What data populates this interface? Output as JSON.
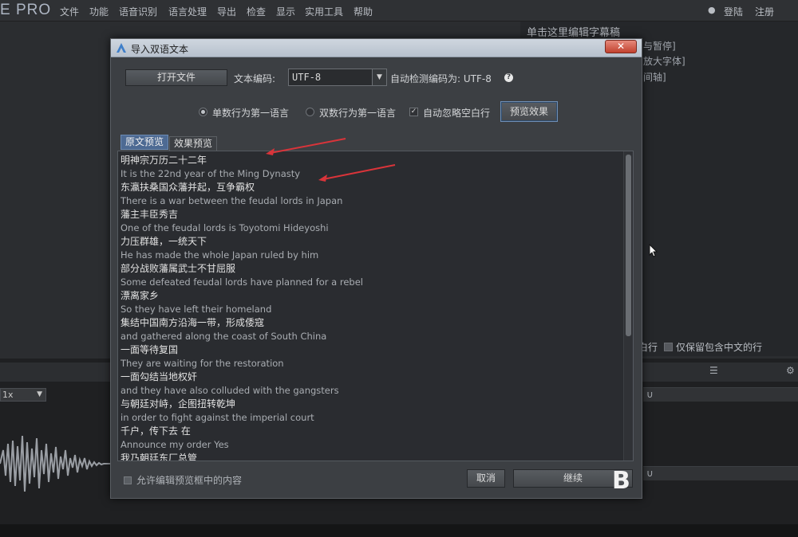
{
  "app": {
    "logo": "E PRO",
    "menu": [
      "文件",
      "功能",
      "语音识别",
      "语言处理",
      "导出",
      "检查",
      "显示",
      "实用工具",
      "帮助"
    ],
    "user": [
      "登陆",
      "注册"
    ]
  },
  "background": {
    "edit_hint": "单击这里编辑字幕稿",
    "side_lines": [
      "与暂停]",
      "放大字体]",
      "间轴]"
    ],
    "row_label_left": "白行",
    "keep_chinese_label": "仅保留包含中文的行",
    "speed": "1x"
  },
  "dialog": {
    "title": "导入双语文本",
    "close_label": "✕",
    "open_file_label": "打开文件",
    "encoding_label": "文本编码:",
    "encoding_value": "UTF-8",
    "auto_detect_label": "自动检测编码为: UTF-8",
    "radio_odd_label": "单数行为第一语言",
    "radio_even_label": "双数行为第一语言",
    "ignore_blank_label": "自动忽略空白行",
    "preview_button_label": "预览效果",
    "tab_original": "原文预览",
    "tab_effect": "效果预览",
    "lines": [
      {
        "lang": "zh",
        "text": "明神宗万历二十二年"
      },
      {
        "lang": "en",
        "text": "It is the 22nd year of the Ming Dynasty"
      },
      {
        "lang": "zh",
        "text": "东瀛扶桑国众藩并起，互争霸权"
      },
      {
        "lang": "en",
        "text": "There is a war between the feudal lords in Japan"
      },
      {
        "lang": "zh",
        "text": "藩主丰臣秀吉"
      },
      {
        "lang": "en",
        "text": "One of the feudal lords is Toyotomi Hideyoshi"
      },
      {
        "lang": "zh",
        "text": "力压群雄，一统天下"
      },
      {
        "lang": "en",
        "text": "He has made the whole Japan ruled by him"
      },
      {
        "lang": "zh",
        "text": "部分战败藩属武士不甘屈服"
      },
      {
        "lang": "en",
        "text": "Some defeated feudal lords have planned for a rebel"
      },
      {
        "lang": "zh",
        "text": "漂离家乡"
      },
      {
        "lang": "en",
        "text": "So they have left their homeland"
      },
      {
        "lang": "zh",
        "text": "集结中国南方沿海一带，形成倭寇"
      },
      {
        "lang": "en",
        "text": "and gathered along the coast of South China"
      },
      {
        "lang": "zh",
        "text": "一面等待复国"
      },
      {
        "lang": "en",
        "text": "They are waiting for the restoration"
      },
      {
        "lang": "zh",
        "text": "一面勾结当地权奸"
      },
      {
        "lang": "en",
        "text": "and they have also colluded with the gangsters"
      },
      {
        "lang": "zh",
        "text": "与朝廷对峙，企图扭转乾坤"
      },
      {
        "lang": "en",
        "text": "in order to fight against the imperial court"
      },
      {
        "lang": "zh",
        "text": "千户，传下去  在"
      },
      {
        "lang": "en",
        "text": "Announce my order Yes"
      },
      {
        "lang": "zh",
        "text": "我乃朝廷东厂总管"
      }
    ],
    "allow_edit_label": "允许编辑预览框中的内容",
    "cancel_label": "取消",
    "continue_label": "继续",
    "watermark": "B"
  },
  "colors": {
    "arrow": "#d9343a",
    "tab_active": "#4d6a93",
    "dialog_bg": "#3c3f43"
  }
}
